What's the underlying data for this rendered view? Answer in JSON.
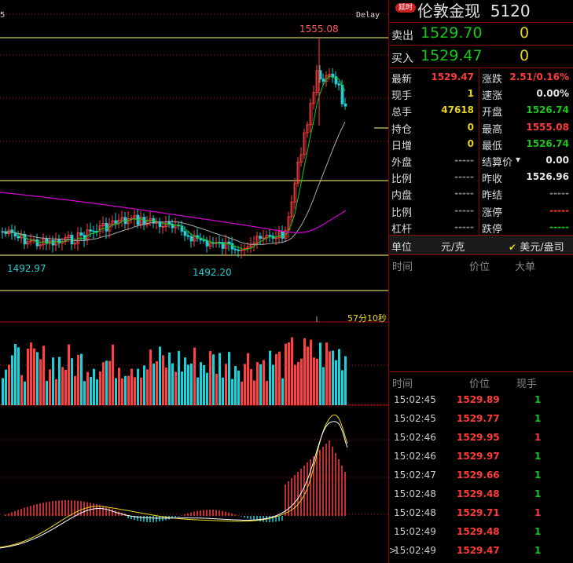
{
  "chart": {
    "delay_text": "Delay",
    "left_edge_label": "5",
    "high_label": "1555.08",
    "low_label_1": "1492.97",
    "low_label_2": "1492.20",
    "time_label": "57分10秒",
    "colors": {
      "up": "#ff4040",
      "down": "#20d0d8",
      "ma5": "#ffffff",
      "ma10": "#e8d41a",
      "ma20": "#18c818",
      "ma60": "#d000d0",
      "grid": "#a01010",
      "ref": "#ffff80"
    }
  },
  "header": {
    "badge": "延时",
    "title": "伦敦金现",
    "code": "5120"
  },
  "quote": {
    "sell_label": "卖出",
    "sell_price": "1529.70",
    "sell_qty": "0",
    "buy_label": "买入",
    "buy_price": "1529.47",
    "buy_qty": "0"
  },
  "stats": {
    "left": [
      {
        "label": "最新",
        "value": "1529.47",
        "color": "red"
      },
      {
        "label": "现手",
        "value": "1",
        "color": "yellow"
      },
      {
        "label": "总手",
        "value": "47618",
        "color": "yellow"
      },
      {
        "label": "持仓",
        "value": "0",
        "color": "yellow"
      },
      {
        "label": "日增",
        "value": "0",
        "color": "yellow"
      },
      {
        "label": "外盘",
        "value": "-----",
        "color": "dash"
      },
      {
        "label": "比例",
        "value": "-----",
        "color": "dash"
      },
      {
        "label": "内盘",
        "value": "-----",
        "color": "dash"
      },
      {
        "label": "比例",
        "value": "-----",
        "color": "dash"
      },
      {
        "label": "杠杆",
        "value": "-----",
        "color": "dash"
      }
    ],
    "right": [
      {
        "label": "涨跌",
        "value": "2.51/0.16%",
        "color": "red"
      },
      {
        "label": "速涨",
        "value": "0.00%",
        "color": "white"
      },
      {
        "label": "开盘",
        "value": "1526.74",
        "color": "green"
      },
      {
        "label": "最高",
        "value": "1555.08",
        "color": "red"
      },
      {
        "label": "最低",
        "value": "1526.74",
        "color": "green"
      },
      {
        "label": "结算价",
        "value": "0.00",
        "color": "white"
      },
      {
        "label": "昨收",
        "value": "1526.96",
        "color": "white"
      },
      {
        "label": "昨结",
        "value": "-----",
        "color": "dash"
      },
      {
        "label": "涨停",
        "value": "-----",
        "color": "red"
      },
      {
        "label": "跌停",
        "value": "-----",
        "color": "green"
      }
    ]
  },
  "unit": {
    "label": "单位",
    "option1": "元/克",
    "option2": "美元/盎司"
  },
  "big_orders": {
    "time_header": "时间",
    "price_header": "价位",
    "big_header": "大单"
  },
  "ticks": {
    "time_header": "时间",
    "price_header": "价位",
    "qty_header": "现手",
    "rows": [
      {
        "time": "15:02:45",
        "price": "1529.89",
        "qty": "1",
        "qty_color": "green"
      },
      {
        "time": "15:02:45",
        "price": "1529.77",
        "qty": "1",
        "qty_color": "green"
      },
      {
        "time": "15:02:46",
        "price": "1529.95",
        "qty": "1",
        "qty_color": "red"
      },
      {
        "time": "15:02:46",
        "price": "1529.97",
        "qty": "1",
        "qty_color": "green"
      },
      {
        "time": "15:02:47",
        "price": "1529.66",
        "qty": "1",
        "qty_color": "green"
      },
      {
        "time": "15:02:48",
        "price": "1529.48",
        "qty": "1",
        "qty_color": "green"
      },
      {
        "time": "15:02:48",
        "price": "1529.71",
        "qty": "1",
        "qty_color": "red"
      },
      {
        "time": "15:02:49",
        "price": "1529.48",
        "qty": "1",
        "qty_color": "green"
      },
      {
        "time": "15:02:49",
        "price": "1529.47",
        "qty": "1",
        "qty_color": "green"
      }
    ],
    "cursor": ">"
  }
}
